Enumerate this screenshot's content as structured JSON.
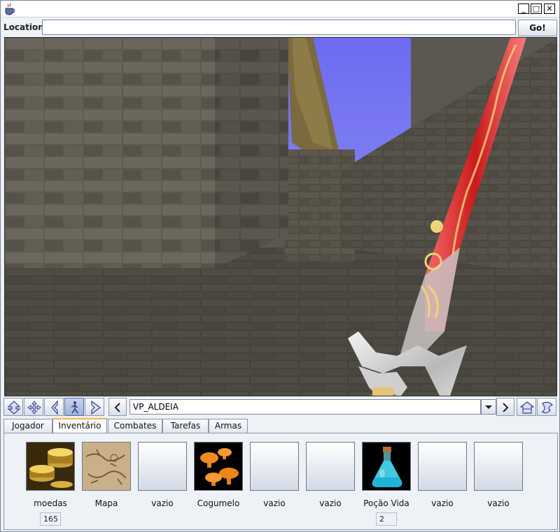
{
  "window": {
    "title": "",
    "controls": {
      "minimize": "_",
      "maximize": "□",
      "close": "✕"
    }
  },
  "location": {
    "label": "Location:",
    "value": "",
    "go_label": "Go!"
  },
  "viewport": {
    "scene": "first-person-dungeon",
    "icon": "sword-in-hand"
  },
  "navbar": {
    "buttons": [
      {
        "name": "fly-icon"
      },
      {
        "name": "pan-icon"
      },
      {
        "name": "turn-icon"
      },
      {
        "name": "walk-icon"
      },
      {
        "name": "examine-icon"
      },
      {
        "name": "previous-viewpoint-icon"
      }
    ],
    "viewpoint": "VP_ALDEIA",
    "right_buttons": [
      {
        "name": "next-viewpoint-icon"
      },
      {
        "name": "home-icon"
      },
      {
        "name": "straighten-icon"
      }
    ]
  },
  "tabs": [
    {
      "label": "Jogador",
      "active": false
    },
    {
      "label": "Inventário",
      "active": true
    },
    {
      "label": "Combates",
      "active": false
    },
    {
      "label": "Tarefas",
      "active": false
    },
    {
      "label": "Armas",
      "active": false
    }
  ],
  "inventory": [
    {
      "label": "moedas",
      "icon": "coins-icon",
      "count": "165"
    },
    {
      "label": "Mapa",
      "icon": "map-icon",
      "count": null
    },
    {
      "label": "vazio",
      "icon": null,
      "count": null
    },
    {
      "label": "Cogumelo",
      "icon": "mushroom-icon",
      "count": null
    },
    {
      "label": "vazio",
      "icon": null,
      "count": null
    },
    {
      "label": "vazio",
      "icon": null,
      "count": null
    },
    {
      "label": "Poção Vida",
      "icon": "potion-icon",
      "count": "2"
    },
    {
      "label": "vazio",
      "icon": null,
      "count": null
    },
    {
      "label": "vazio",
      "icon": null,
      "count": null
    }
  ]
}
